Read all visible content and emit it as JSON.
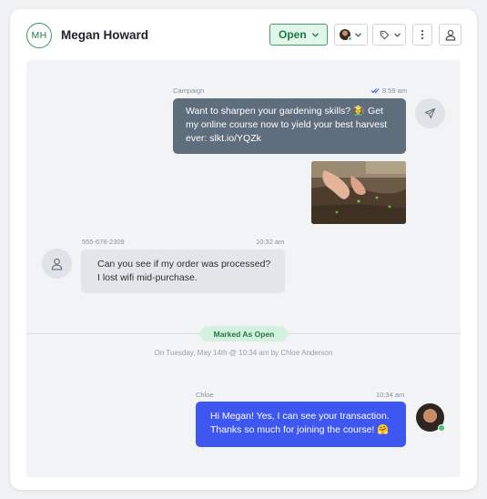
{
  "contact": {
    "initials": "MH",
    "name": "Megan Howard"
  },
  "header": {
    "status_label": "Open",
    "icons": {
      "status_chevron": "chevron-down-icon",
      "assign": "agent-avatar",
      "tag": "tag-icon",
      "more": "more-vertical-icon",
      "profile": "user-icon"
    }
  },
  "messages": {
    "campaign": {
      "source_label": "Campaign",
      "time": "8:59 am",
      "status_icon": "double-check-icon",
      "text": "Want to sharpen your gardening skills? 🧑‍🌾 Get my online course now to yield your best harvest ever: slkt.io/YQZk",
      "line1": "Want to sharpen your gardening skills? 🧑‍🌾 Get",
      "line2": "my online course now to yield your best harvest",
      "line3": "ever: slkt.io/YQZk",
      "image_alt": "hands planting seedlings in soil"
    },
    "incoming": {
      "sender": "555-678-2309",
      "time": "10:32 am",
      "line1": "Can you see if my order was processed?",
      "line2": "I lost wifi mid-purchase."
    },
    "event": {
      "label": "Marked As Open",
      "meta": "On Tuesday, May 14th @ 10:34 am by Chloe Anderson"
    },
    "outgoing": {
      "sender": "Chloe",
      "time": "10:34 am",
      "line1": "Hi Megan! Yes, I can see your transaction.",
      "line2": "Thanks so much for joining the course! 🤗"
    }
  },
  "colors": {
    "accent_green": "#3da265",
    "campaign_bubble": "#5f6e7c",
    "outgoing_bubble": "#3e57f0",
    "incoming_bubble": "#e3e6e9",
    "event_pill": "#d3f1de"
  }
}
